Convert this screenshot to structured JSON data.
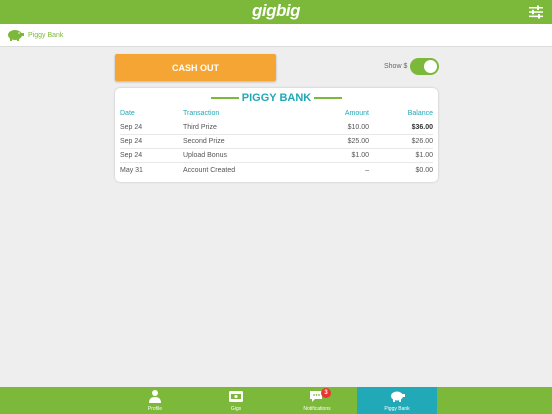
{
  "app": {
    "logo": "gigbig"
  },
  "breadcrumb": {
    "label": "Piggy Bank"
  },
  "actions": {
    "cashout_label": "CASH OUT",
    "show_label": "Show $",
    "show_enabled": true
  },
  "piggy_bank": {
    "title": "PIGGY BANK",
    "columns": {
      "date": "Date",
      "transaction": "Transaction",
      "amount": "Amount",
      "balance": "Balance"
    },
    "rows": [
      {
        "date": "Sep 24",
        "transaction": "Third Prize",
        "amount": "$10.00",
        "balance": "$36.00"
      },
      {
        "date": "Sep 24",
        "transaction": "Second Prize",
        "amount": "$25.00",
        "balance": "$26.00"
      },
      {
        "date": "Sep 24",
        "transaction": "Upload Bonus",
        "amount": "$1.00",
        "balance": "$1.00"
      },
      {
        "date": "May 31",
        "transaction": "Account Created",
        "amount": "–",
        "balance": "$0.00"
      }
    ]
  },
  "tabbar": {
    "items": [
      {
        "label": "Profile",
        "icon": "person-icon"
      },
      {
        "label": "Gigs",
        "icon": "ticket-icon"
      },
      {
        "label": "Notifications",
        "icon": "chat-bubble-icon",
        "badge": "3"
      },
      {
        "label": "Piggy Bank",
        "icon": "piggy-bank-icon",
        "active": true
      }
    ]
  },
  "colors": {
    "brand_green": "#7cb83a",
    "accent_teal": "#21a8b8",
    "cashout_orange": "#f4a534",
    "badge_red": "#e33333"
  }
}
